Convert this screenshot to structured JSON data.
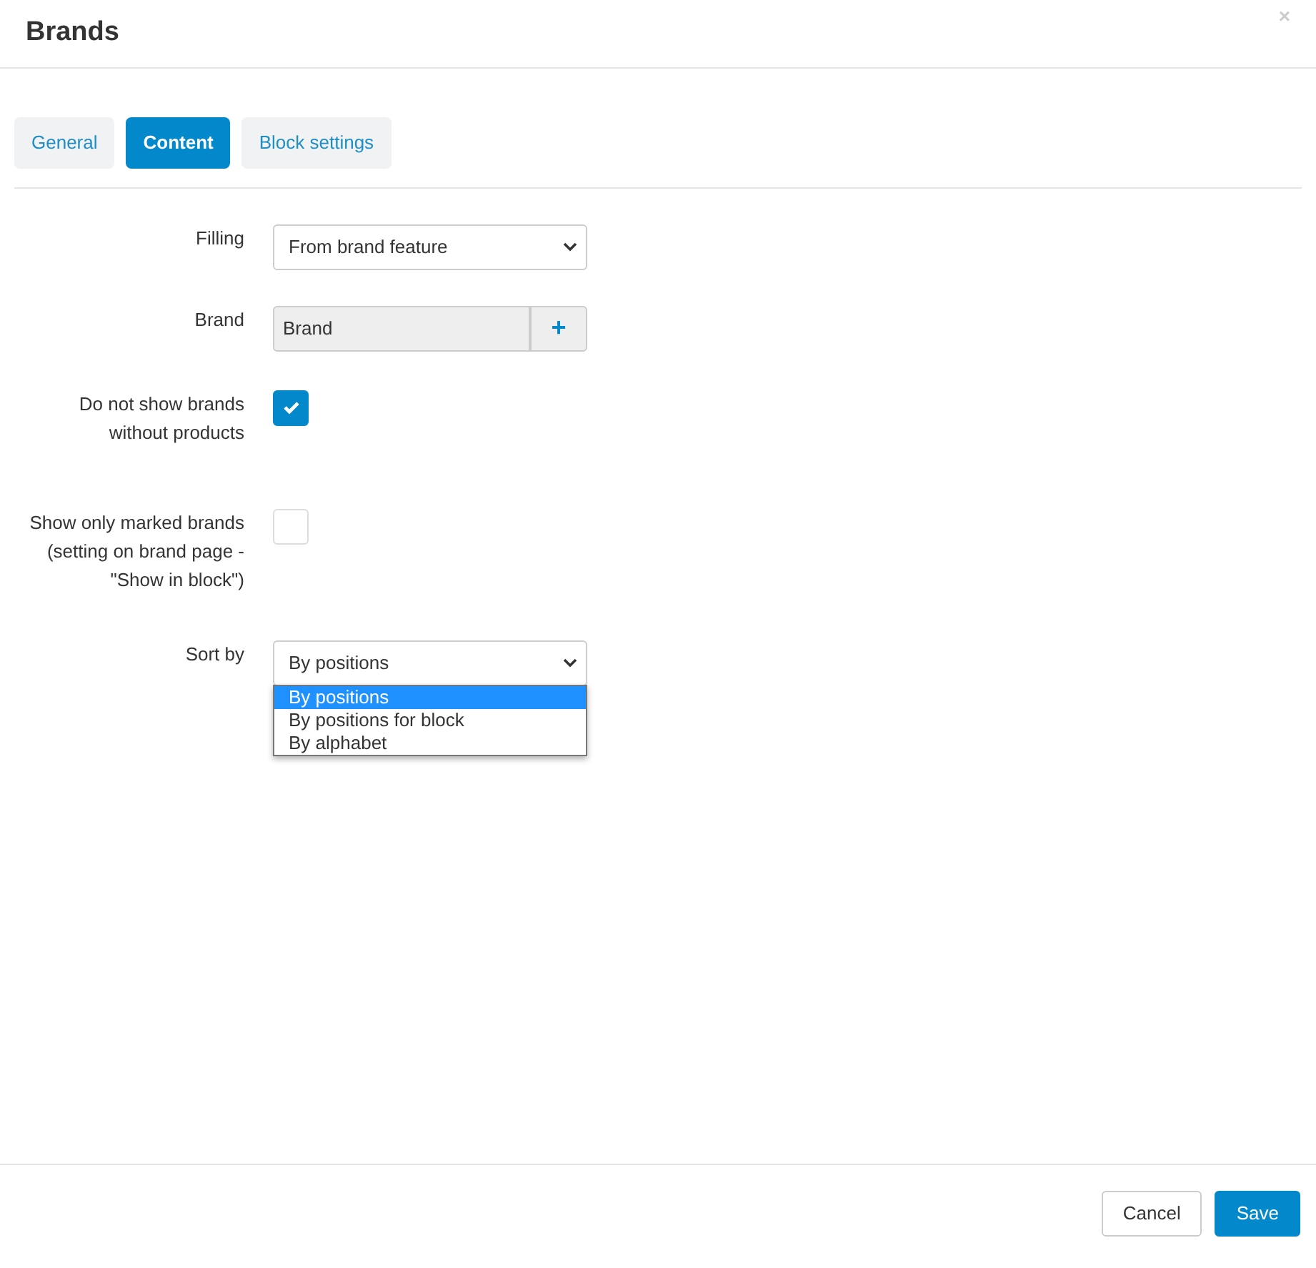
{
  "window": {
    "title": "Brands",
    "close": "×"
  },
  "tabs": [
    {
      "label": "General",
      "selected": false
    },
    {
      "label": "Content",
      "selected": true
    },
    {
      "label": "Block settings",
      "selected": false
    }
  ],
  "fields": [
    {
      "kind": "select",
      "label": "Filling",
      "value": "From brand feature"
    },
    {
      "kind": "addon",
      "label": "Brand",
      "value": "Brand",
      "addon": "+"
    },
    {
      "kind": "checkbox",
      "label": "Do not show brands without products",
      "checked": true
    },
    {
      "kind": "checkbox",
      "label": "Show only marked brands (setting on brand page - \"Show in block\")",
      "checked": false
    },
    {
      "kind": "select",
      "label": "Sort by",
      "value": "By positions",
      "expanded": true,
      "options": [
        {
          "label": "By positions",
          "selected": true
        },
        {
          "label": "By positions for block",
          "selected": false
        },
        {
          "label": "By alphabet",
          "selected": false
        }
      ]
    }
  ],
  "buttons": [
    {
      "label": "Cancel",
      "kind": "secondary"
    },
    {
      "label": "Save",
      "kind": "primary"
    }
  ]
}
